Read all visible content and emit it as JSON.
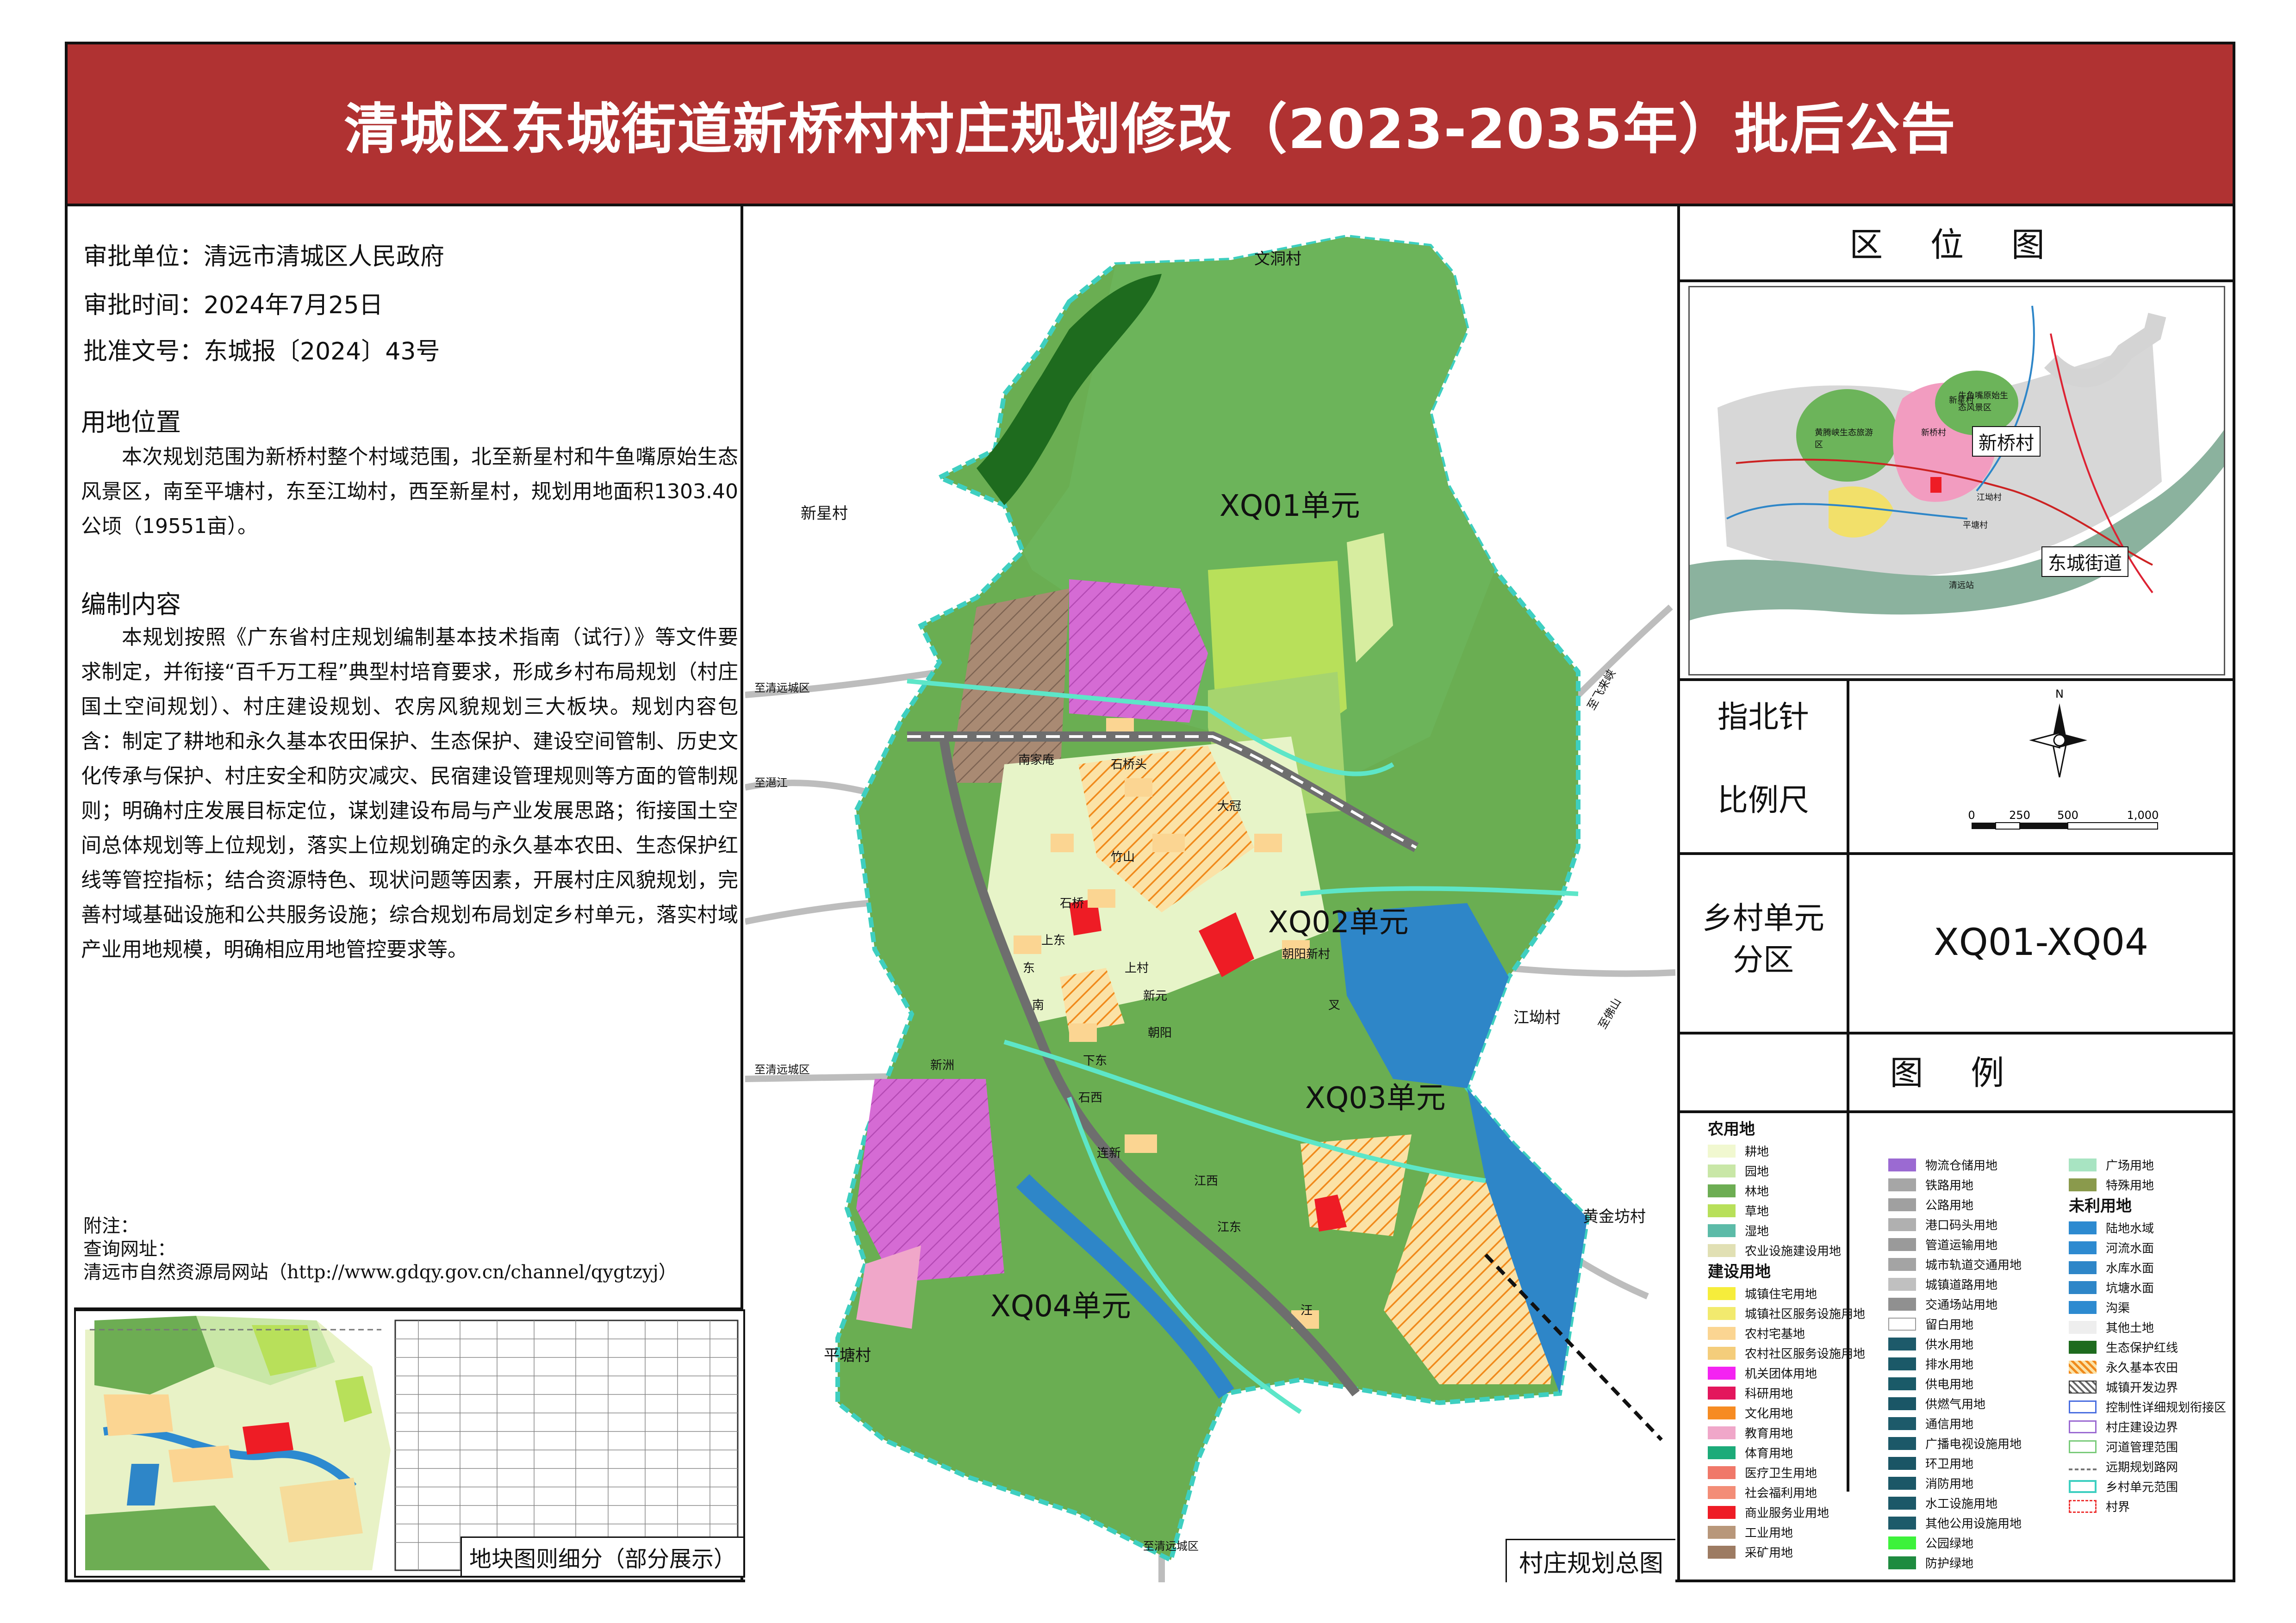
{
  "title": "清城区东城街道新桥村村庄规划修改（2023-2035年）批后公告",
  "approval": {
    "unit_label": "审批单位：",
    "unit": "清远市清城区人民政府",
    "time_label": "审批时间：",
    "time": "2024年7月25日",
    "doc_label": "批准文号：",
    "doc": "东城报〔2024〕43号"
  },
  "land_location": {
    "heading": "用地位置",
    "text": "本次规划范围为新桥村整个村域范围，北至新星村和牛鱼嘴原始生态风景区，南至平塘村，东至江坳村，西至新星村，规划用地面积1303.40公顷（19551亩）。"
  },
  "content": {
    "heading": "编制内容",
    "text": "本规划按照《广东省村庄规划编制基本技术指南（试行）》等文件要求制定，并衔接“百千万工程”典型村培育要求，形成乡村布局规划（村庄国土空间规划）、村庄建设规划、农房风貌规划三大板块。规划内容包含：制定了耕地和永久基本农田保护、生态保护、建设空间管制、历史文化传承与保护、村庄安全和防灾减灾、民宿建设管理规则等方面的管制规则；明确村庄发展目标定位，谋划建设布局与产业发展思路；衔接国土空间总体规划等上位规划，落实上位规划确定的永久基本农田、生态保护红线等管控指标；结合资源特色、现状问题等因素，开展村庄风貌规划，完善村域基础设施和公共服务设施；综合规划布局划定乡村单元，落实村域产业用地规模，明确相应用地管控要求等。"
  },
  "notes": {
    "attach": "附注：",
    "query": "查询网址：",
    "site": "清远市自然资源局网站（http://www.gdqy.gov.cn/channel/qygtzyj）"
  },
  "thumb_label": "地块图则细分（部分展示）",
  "map": {
    "title": "村庄规划总图",
    "units": [
      "XQ01单元",
      "XQ02单元",
      "XQ03单元",
      "XQ04单元"
    ],
    "villages": [
      "文洞村",
      "新星村",
      "江坳村",
      "黄金坊村",
      "平塘村"
    ],
    "hamlets": [
      "南家庵",
      "石桥头",
      "大冠",
      "竹山",
      "石桥",
      "上东",
      "朝阳新村",
      "东",
      "上村",
      "新元",
      "南",
      "朝阳",
      "下东",
      "新洲",
      "石西",
      "连新",
      "江西",
      "江东",
      "汪",
      "叉"
    ],
    "roads": [
      "至清远城区",
      "至潖江",
      "至清远城区",
      "至清远城区",
      "至飞来峡",
      "至佛山"
    ]
  },
  "location_map": {
    "heading": "区 位 图",
    "callouts": [
      "新桥村",
      "东城街道"
    ],
    "labels": [
      "新星村",
      "黄腾峡生态旅游区",
      "新桥村",
      "牛鱼嘴原始生态风景区",
      "江坳村",
      "平塘村",
      "清远站"
    ]
  },
  "north_scale": {
    "north_label": "指北针",
    "scale_label": "比例尺",
    "north_letter": "N",
    "ticks": [
      "0",
      "250",
      "500",
      "1,000"
    ]
  },
  "units_row": {
    "label": "乡村单元分区",
    "value": "XQ01-XQ04"
  },
  "legend": {
    "heading": "图 例",
    "col1": [
      {
        "group": "农用地"
      },
      {
        "label": "耕地",
        "color": "#f1f8d0"
      },
      {
        "label": "园地",
        "color": "#c9e7a7"
      },
      {
        "label": "林地",
        "color": "#6dad53"
      },
      {
        "label": "草地",
        "color": "#b8e05a"
      },
      {
        "label": "湿地",
        "color": "#5cbba8"
      },
      {
        "label": "农业设施建设用地",
        "color": "#e1e0b4"
      },
      {
        "group": "建设用地"
      },
      {
        "label": "城镇住宅用地",
        "color": "#f6ed3b"
      },
      {
        "label": "城镇社区服务设施用地",
        "color": "#f2ea6e"
      },
      {
        "label": "农村宅基地",
        "color": "#fbd592"
      },
      {
        "label": "农村社区服务设施用地",
        "color": "#f4cd7b"
      },
      {
        "label": "机关团体用地",
        "color": "#f423f2"
      },
      {
        "label": "科研用地",
        "color": "#e3165c"
      },
      {
        "label": "文化用地",
        "color": "#f68b22"
      },
      {
        "label": "教育用地",
        "color": "#f0a7c9"
      },
      {
        "label": "体育用地",
        "color": "#1cab79"
      },
      {
        "label": "医疗卫生用地",
        "color": "#f07869"
      },
      {
        "label": "社会福利用地",
        "color": "#f38d77"
      },
      {
        "label": "商业服务业用地",
        "color": "#ee1c25"
      },
      {
        "label": "工业用地",
        "color": "#b8977a"
      },
      {
        "label": "采矿用地",
        "color": "#9d7b62"
      }
    ],
    "col2": [
      {
        "label": "物流仓储用地",
        "color": "#9b6ad2"
      },
      {
        "label": "铁路用地",
        "color": "#a6a6a6"
      },
      {
        "label": "公路用地",
        "color": "#a0a0a0"
      },
      {
        "label": "港口码头用地",
        "color": "#b0b0b0"
      },
      {
        "label": "管道运输用地",
        "color": "#9a9a9a"
      },
      {
        "label": "城市轨道交通用地",
        "color": "#a4a4a4"
      },
      {
        "label": "城镇道路用地",
        "color": "#c0c0c0"
      },
      {
        "label": "交通场站用地",
        "color": "#909090"
      },
      {
        "label": "留白用地",
        "color": "#ffffff"
      },
      {
        "label": "供水用地",
        "color": "#1d5a6a"
      },
      {
        "label": "排水用地",
        "color": "#1b5968"
      },
      {
        "label": "供电用地",
        "color": "#1a5a68"
      },
      {
        "label": "供燃气用地",
        "color": "#1a5666"
      },
      {
        "label": "通信用地",
        "color": "#1d5a6a"
      },
      {
        "label": "广播电视设施用地",
        "color": "#1c5868"
      },
      {
        "label": "环卫用地",
        "color": "#1a5565"
      },
      {
        "label": "消防用地",
        "color": "#1b5767"
      },
      {
        "label": "水工设施用地",
        "color": "#1c5868"
      },
      {
        "label": "其他公用设施用地",
        "color": "#1d5a6a"
      },
      {
        "label": "公园绿地",
        "color": "#3df23b"
      },
      {
        "label": "防护绿地",
        "color": "#1e8b3f"
      }
    ],
    "col3": [
      {
        "label": "广场用地",
        "color": "#a8e4c2"
      },
      {
        "label": "特殊用地",
        "color": "#8a9a4c"
      },
      {
        "group": "未利用地"
      },
      {
        "label": "陆地水域",
        "color": "#2d8ad0"
      },
      {
        "label": "河流水面",
        "color": "#2d8ad0"
      },
      {
        "label": "水库水面",
        "color": "#2e86c8"
      },
      {
        "label": "坑塘水面",
        "color": "#2e86c8"
      },
      {
        "label": "沟渠",
        "color": "#2d8ad0"
      },
      {
        "label": "其他土地",
        "color": "#eeeeee"
      },
      {
        "label": "生态保护红线",
        "color": "#1e6b1e"
      },
      {
        "label": "永久基本农田",
        "color": "hatch-orange"
      },
      {
        "label": "城镇开发边界",
        "color": "hatch-grey"
      },
      {
        "label": "控制性详细规划衔接区",
        "color": "outline-blue"
      },
      {
        "label": "村庄建设边界",
        "color": "outline-purple"
      },
      {
        "label": "河道管理范围",
        "color": "outline-green"
      },
      {
        "label": "远期规划路网",
        "color": "dash-grey"
      },
      {
        "label": "乡村单元范围",
        "color": "outline-cyan"
      },
      {
        "label": "村界",
        "color": "dash-red"
      }
    ]
  }
}
